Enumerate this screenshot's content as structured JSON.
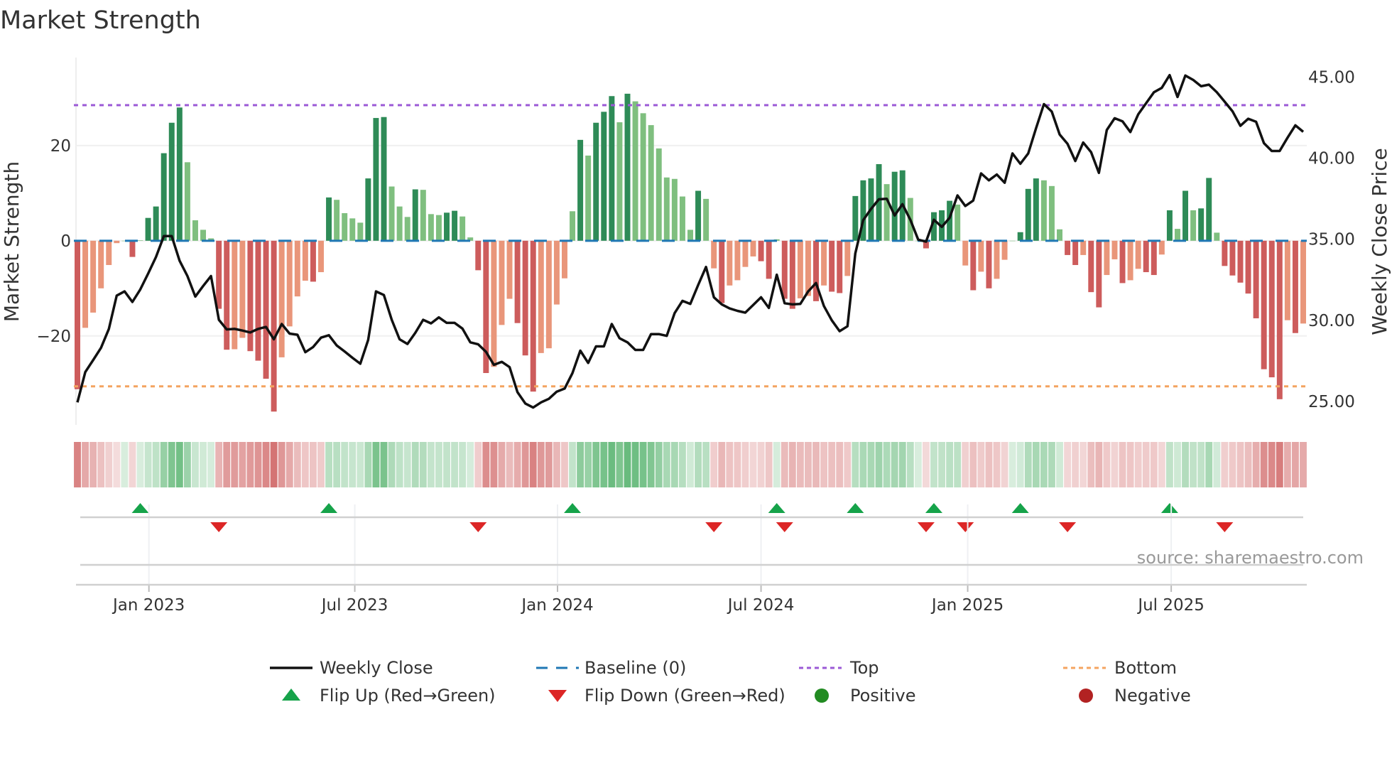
{
  "chart_data": {
    "type": "bar",
    "title": "Market Strength",
    "ylabel": "Market Strength",
    "y2label": "Weekly Close Price",
    "ylim": [
      -38.7,
      38.5
    ],
    "y2lim": [
      23.55,
      46.2
    ],
    "yticks": [
      {
        "v": 20,
        "label": "20"
      },
      {
        "v": 0,
        "label": "0"
      },
      {
        "v": -20,
        "label": "−20"
      }
    ],
    "y2ticks": [
      {
        "v": 45,
        "label": "45.00"
      },
      {
        "v": 40,
        "label": "40.00"
      },
      {
        "v": 35,
        "label": "35.00"
      },
      {
        "v": 30,
        "label": "30.00"
      },
      {
        "v": 25,
        "label": "25.00"
      }
    ],
    "xticks": [
      {
        "week": 9.1,
        "label": "Jan 2023"
      },
      {
        "week": 35.3,
        "label": "Jul 2023"
      },
      {
        "week": 61.1,
        "label": "Jan 2024"
      },
      {
        "week": 87.0,
        "label": "Jul 2024"
      },
      {
        "week": 113.3,
        "label": "Jan 2025"
      },
      {
        "week": 139.2,
        "label": "Jul 2025"
      }
    ],
    "top_level": 28.5,
    "bottom_level": -30.6,
    "strength": [
      -31.2,
      -18.3,
      -15.1,
      -10.0,
      -5.1,
      -0.5,
      0,
      -3.4,
      0.1,
      4.8,
      7.2,
      18.4,
      24.8,
      28.0,
      16.5,
      4.3,
      2.3,
      0.5,
      -14.3,
      -22.9,
      -22.8,
      -20.4,
      -23.2,
      -25.2,
      -29.0,
      -35.9,
      -24.5,
      -18.0,
      -11.7,
      -8.4,
      -8.6,
      -6.6,
      9.1,
      8.6,
      5.8,
      4.7,
      3.8,
      13.1,
      25.8,
      26.0,
      11.4,
      7.2,
      5.0,
      10.8,
      10.7,
      5.6,
      5.4,
      5.9,
      6.3,
      5.1,
      0.7,
      -6.2,
      -27.8,
      -26.5,
      -17.7,
      -12.2,
      -17.3,
      -24.1,
      -31.7,
      -23.6,
      -22.6,
      -13.4,
      -7.9,
      6.2,
      21.2,
      17.9,
      24.8,
      27.1,
      30.4,
      24.9,
      30.9,
      29.3,
      26.8,
      24.3,
      19.4,
      13.3,
      13.0,
      9.3,
      2.3,
      10.5,
      8.8,
      -5.8,
      -13.1,
      -9.4,
      -8.3,
      -5.5,
      -3.3,
      -4.3,
      -8.0,
      0.3,
      -12.2,
      -14.3,
      -12.1,
      -11.6,
      -12.7,
      -9.4,
      -10.7,
      -11.0,
      -7.4,
      9.4,
      12.7,
      13.1,
      16.1,
      11.9,
      14.5,
      14.8,
      9.0,
      0,
      -1.6,
      6.0,
      6.4,
      8.4,
      7.6,
      -5.2,
      -10.4,
      -6.5,
      -10.0,
      -8.0,
      -4.0,
      0,
      1.8,
      10.9,
      13.1,
      12.7,
      11.5,
      2.4,
      -3.0,
      -5.1,
      -3.0,
      -10.8,
      -14.0,
      -7.2,
      -3.9,
      -8.9,
      -8.3,
      -5.9,
      -6.6,
      -7.2,
      -2.9,
      6.4,
      2.5,
      10.5,
      6.4,
      6.8,
      13.2,
      1.7,
      -5.3,
      -7.3,
      -8.8,
      -11.1,
      -16.3,
      -27.0,
      -28.7,
      -33.3,
      -16.7,
      -19.4,
      -17.4
    ],
    "weekly_close": [
      24.94,
      26.81,
      27.54,
      28.3,
      29.47,
      31.52,
      31.78,
      31.13,
      31.9,
      32.88,
      33.9,
      35.19,
      35.19,
      33.68,
      32.73,
      31.46,
      32.11,
      32.73,
      30.03,
      29.44,
      29.47,
      29.37,
      29.25,
      29.47,
      29.59,
      28.83,
      29.77,
      29.18,
      29.11,
      28.03,
      28.35,
      28.93,
      29.08,
      28.45,
      28.08,
      27.69,
      27.32,
      28.79,
      31.78,
      31.56,
      30.03,
      28.83,
      28.54,
      29.23,
      30.03,
      29.81,
      30.18,
      29.84,
      29.84,
      29.49,
      28.64,
      28.52,
      28.06,
      27.25,
      27.44,
      27.11,
      25.57,
      24.87,
      24.62,
      24.94,
      25.16,
      25.6,
      25.79,
      26.74,
      28.13,
      27.37,
      28.39,
      28.39,
      29.77,
      28.89,
      28.64,
      28.17,
      28.17,
      29.15,
      29.15,
      29.04,
      30.44,
      31.2,
      31.01,
      32.18,
      33.29,
      31.42,
      30.98,
      30.73,
      30.58,
      30.47,
      30.94,
      31.42,
      30.76,
      32.81,
      31.05,
      30.98,
      31.01,
      31.78,
      32.3,
      30.88,
      30.0,
      29.33,
      29.63,
      34.12,
      36.17,
      36.87,
      37.46,
      37.49,
      36.46,
      37.16,
      36.2,
      34.97,
      34.85,
      36.2,
      35.76,
      36.32,
      37.7,
      37.05,
      37.38,
      39.06,
      38.63,
      38.99,
      38.48,
      40.29,
      39.65,
      40.29,
      41.84,
      43.33,
      42.87,
      41.46,
      40.88,
      39.82,
      40.96,
      40.37,
      39.09,
      41.73,
      42.46,
      42.27,
      41.61,
      42.7,
      43.38,
      44.06,
      44.33,
      45.12,
      43.77,
      45.09,
      44.82,
      44.43,
      44.53,
      44.06,
      43.48,
      42.89,
      41.99,
      42.43,
      42.24,
      40.92,
      40.44,
      40.44,
      41.26,
      42.02,
      41.62
    ],
    "legend": [
      {
        "key": "close",
        "label": "Weekly Close"
      },
      {
        "key": "baseline",
        "label": "Baseline (0)"
      },
      {
        "key": "top",
        "label": "Top"
      },
      {
        "key": "bottom",
        "label": "Bottom"
      },
      {
        "key": "flipup",
        "label": "Flip Up (Red→Green)"
      },
      {
        "key": "flipdown",
        "label": "Flip Down (Green→Red)"
      },
      {
        "key": "positive",
        "label": "Positive"
      },
      {
        "key": "negative",
        "label": "Negative"
      }
    ],
    "legend_position": "bottom",
    "grid": true
  },
  "source": "source: sharemaestro.com",
  "colors": {
    "pos_dark": "#2e8b57",
    "pos_light": "#7fbf7f",
    "neg_dark": "#cd5c5c",
    "neg_light": "#e9967a",
    "baseline": "#1f77b4",
    "top": "#9b59d6",
    "bottom": "#f4a460",
    "flip_up": "#16a34a",
    "flip_down": "#dc2626",
    "positive": "#228b22",
    "negative": "#b22222"
  }
}
